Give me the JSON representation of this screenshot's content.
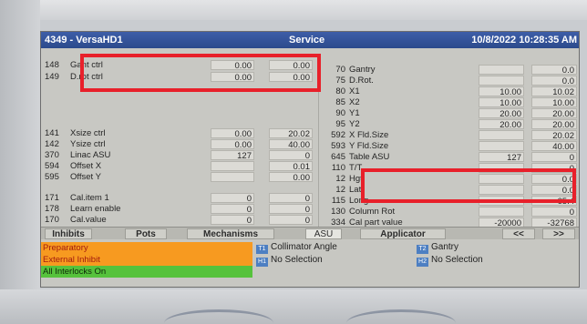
{
  "title": {
    "left": "4349 - VersaHD1",
    "center": "Service",
    "right": "10/8/2022 10:28:35 AM"
  },
  "left_rows_top": [
    {
      "num": "148",
      "name": "Gant ctrl",
      "v1": "0.00",
      "v2": "0.00"
    },
    {
      "num": "149",
      "name": "D.rot ctrl",
      "v1": "0.00",
      "v2": "0.00"
    }
  ],
  "left_rows_mid": [
    {
      "num": "141",
      "name": "Xsize ctrl",
      "v1": "0.00",
      "v2": "20.02"
    },
    {
      "num": "142",
      "name": "Ysize ctrl",
      "v1": "0.00",
      "v2": "40.00"
    },
    {
      "num": "370",
      "name": "Linac ASU",
      "v1": "127",
      "v2": "0"
    },
    {
      "num": "594",
      "name": "Offset X",
      "v1": "",
      "v2": "0.01"
    },
    {
      "num": "595",
      "name": "Offset Y",
      "v1": "",
      "v2": "0.00"
    }
  ],
  "left_rows_bot": [
    {
      "num": "171",
      "name": "Cal.item 1",
      "v1": "0",
      "v2": "0"
    },
    {
      "num": "178",
      "name": "Learn enable",
      "v1": "0",
      "v2": "0"
    },
    {
      "num": "170",
      "name": "Cal.value",
      "v1": "0",
      "v2": "0"
    }
  ],
  "right_rows": [
    {
      "num": "70",
      "name": "Gantry",
      "v1": "",
      "v2": "0.0"
    },
    {
      "num": "75",
      "name": "D.Rot.",
      "v1": "",
      "v2": "0.0"
    },
    {
      "num": "80",
      "name": "X1",
      "v1": "10.00",
      "v2": "10.02"
    },
    {
      "num": "85",
      "name": "X2",
      "v1": "10.00",
      "v2": "10.00"
    },
    {
      "num": "90",
      "name": "Y1",
      "v1": "20.00",
      "v2": "20.00"
    },
    {
      "num": "95",
      "name": "Y2",
      "v1": "20.00",
      "v2": "20.00"
    },
    {
      "num": "592",
      "name": "X Fld.Size",
      "v1": "",
      "v2": "20.02"
    },
    {
      "num": "593",
      "name": "Y Fld.Size",
      "v1": "",
      "v2": "40.00"
    },
    {
      "num": "645",
      "name": "Table ASU",
      "v1": "127",
      "v2": "0"
    },
    {
      "num": "110",
      "name": "T/T",
      "v1": "",
      "v2": "0"
    },
    {
      "num": "12",
      "name": "Hgt.",
      "v1": "",
      "v2": "0.0"
    },
    {
      "num": "12",
      "name": "Lat.",
      "v1": "",
      "v2": "0.0"
    },
    {
      "num": "115",
      "name": "Long.",
      "v1": "",
      "v2": "65.4"
    },
    {
      "num": "130",
      "name": "Column Rot",
      "v1": "",
      "v2": "0"
    },
    {
      "num": "334",
      "name": "Cal part value",
      "v1": "-20000",
      "v2": "-32768"
    }
  ],
  "tabs": [
    "Inhibits",
    "Pots",
    "Mechanisms",
    "ASU",
    "Applicator",
    "<<",
    ">>"
  ],
  "interlocks": [
    "Preparatory",
    "External Inhibit",
    "All Interlocks On"
  ],
  "selections": {
    "t1_key": "T1",
    "t1_label": "Collimator Angle",
    "h1_key": "H1",
    "h1_label": "No Selection",
    "t2_key": "T2",
    "t2_label": "Gantry",
    "h2_key": "H2",
    "h2_label": "No Selection"
  },
  "colors": {
    "highlight": "#e8202a",
    "titlebar": "#2c4a8c",
    "interlock_warn": "#f79a20",
    "interlock_ok": "#56c23c"
  }
}
